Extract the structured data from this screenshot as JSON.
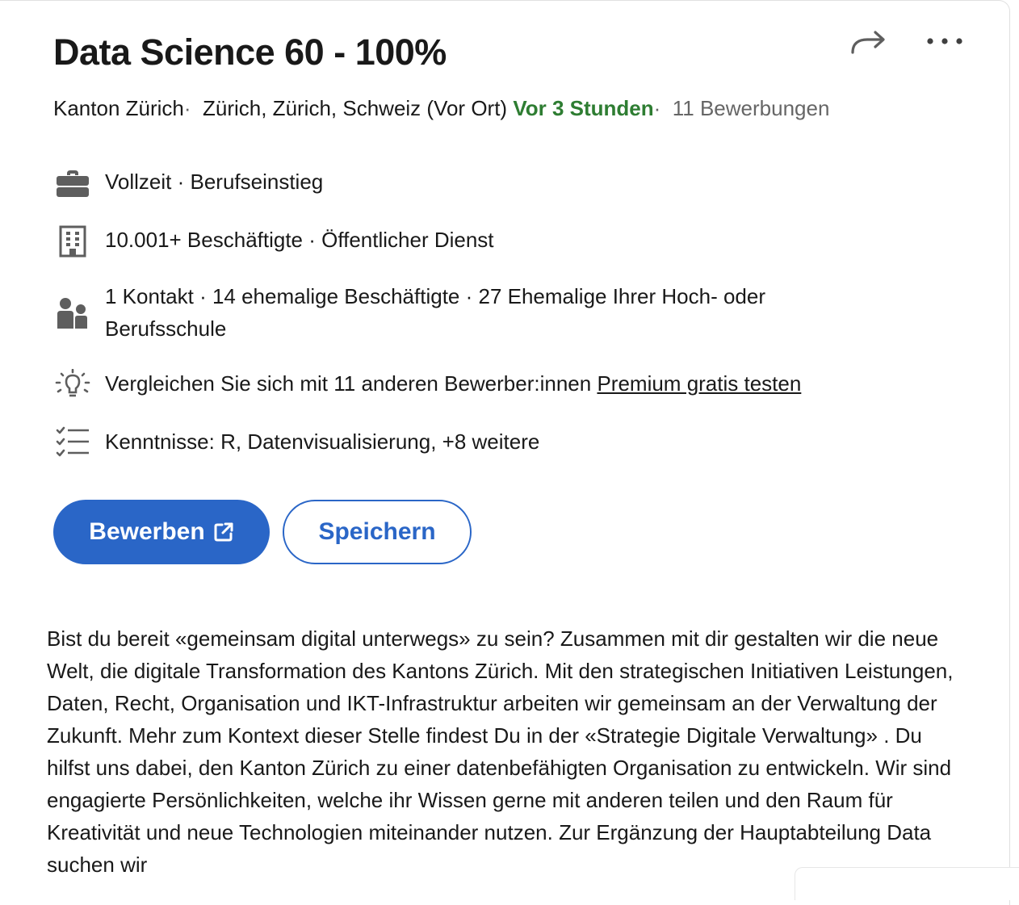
{
  "job": {
    "title": "Data Science 60 - 100%",
    "company": "Kanton Zürich",
    "location": "Zürich, Zürich, Schweiz (Vor Ort)",
    "posted": "Vor 3 Stunden",
    "applicants": "11 Bewerbungen",
    "separator": "·"
  },
  "insights": {
    "employment": "Vollzeit · Berufseinstieg",
    "company_size": "10.001+ Beschäftigte · Öffentlicher Dienst",
    "network": "1 Kontakt · 14 ehemalige Beschäftigte · 27 Ehemalige Ihrer Hoch- oder Berufsschule",
    "compare": "Vergleichen Sie sich mit 11 anderen Bewerber:innen",
    "premium_link": "Premium gratis testen",
    "skills": "Kenntnisse: R, Datenvisualisierung, +8 weitere"
  },
  "actions": {
    "apply_label": "Bewerben",
    "save_label": "Speichern"
  },
  "description": "Bist du bereit «gemeinsam digital unterwegs» zu sein? Zusammen mit dir gestalten wir die neue Welt, die digitale Transformation des Kantons Zürich. Mit den strategischen Initiativen Leistungen, Daten, Recht, Organisation und IKT-Infrastruktur arbeiten wir gemeinsam an der Verwaltung der Zukunft. Mehr zum Kontext dieser Stelle findest Du in der «Strategie Digitale Verwaltung» . Du hilfst uns dabei, den Kanton Zürich zu einer datenbefähigten Organisation zu entwickeln. Wir sind engagierte Persönlichkeiten, welche ihr Wissen gerne mit anderen teilen und den Raum für Kreativität und neue Technologien miteinander nutzen. Zur Ergänzung der Hauptabteilung Data suchen wir",
  "colors": {
    "accent": "#2a66c7",
    "posted_green": "#2e7d32",
    "muted": "#666666",
    "icon": "#5e5e5e"
  },
  "icons": [
    "share-icon",
    "more-icon",
    "briefcase-icon",
    "building-icon",
    "people-icon",
    "lightbulb-icon",
    "checklist-icon",
    "external-link-icon"
  ]
}
